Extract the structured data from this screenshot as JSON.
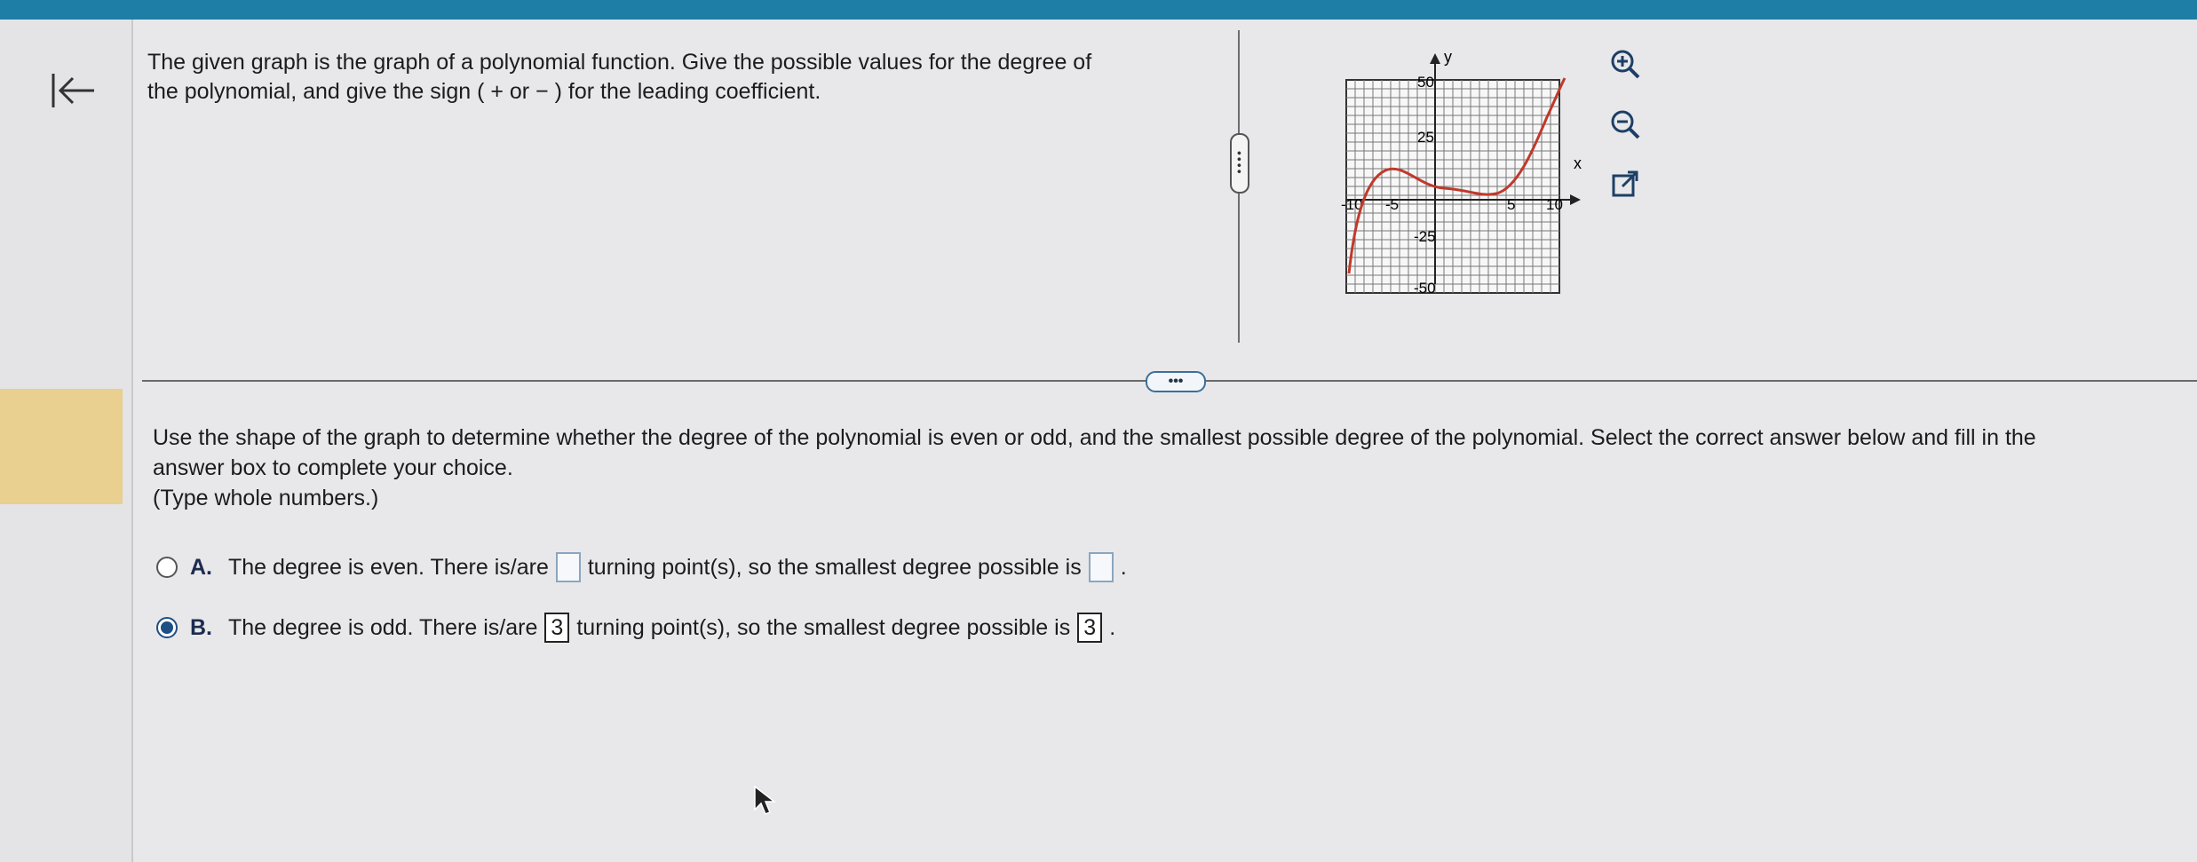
{
  "question": {
    "text_line1": "The given graph is the graph of a polynomial function. Give the possible values for the degree of",
    "text_line2": "the polynomial, and give the sign ( + or − ) for the leading coefficient."
  },
  "graph": {
    "y_axis_label": "y",
    "x_axis_label": "x",
    "x_ticks": [
      "-10",
      "-5",
      "5",
      "10"
    ],
    "y_ticks": [
      "50",
      "25",
      "-25",
      "-50"
    ],
    "curve_color": "#c0392b"
  },
  "tools": {
    "zoom_in_icon": "zoom-in-icon",
    "zoom_out_icon": "zoom-out-icon",
    "popout_icon": "external-link-icon"
  },
  "handles": {
    "horizontal": "•••",
    "vertical": "••••"
  },
  "instructions": {
    "line1": "Use the shape of the graph to determine whether the degree of the polynomial is even or odd, and the smallest possible degree of the polynomial. Select the correct answer below and fill in the",
    "line2": "answer box to complete your choice.",
    "line3": "(Type whole numbers.)"
  },
  "options": [
    {
      "letter": "A.",
      "text_before": "The degree is even. There is/are",
      "box1": "",
      "text_middle": "turning point(s), so the smallest degree possible is",
      "box2": "",
      "text_after": ".",
      "selected": false
    },
    {
      "letter": "B.",
      "text_before": "The degree is odd. There is/are",
      "box1": "3",
      "text_middle": "turning point(s), so the smallest degree possible is",
      "box2": "3",
      "text_after": ".",
      "selected": true
    }
  ],
  "colors": {
    "topbar": "#1f7ea6",
    "accent": "#1d4f86",
    "highlight": "#e9cf90"
  }
}
